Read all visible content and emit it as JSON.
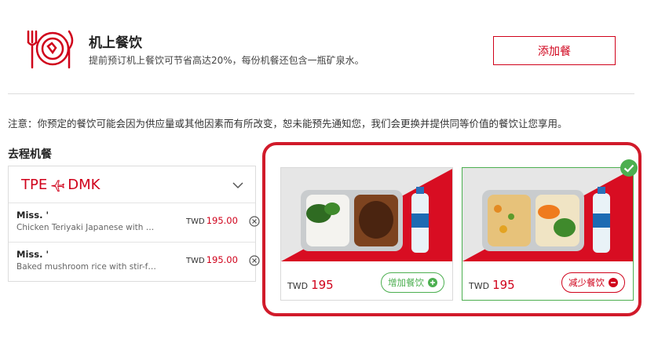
{
  "header": {
    "title": "机上餐饮",
    "subtitle": "提前预订机上餐饮可节省高达20%，每份机餐还包含一瓶矿泉水。",
    "add_meal_label": "添加餐"
  },
  "notice": "注意：你预定的餐饮可能会因为供应量或其他因素而有所改变，恕未能预先通知您，我们会更换并提供同等价值的餐饮让您享用。",
  "section_title": "去程机餐",
  "route": {
    "origin": "TPE",
    "destination": "DMK"
  },
  "passengers": [
    {
      "name": "Miss. '",
      "meal": "Chicken Teriyaki Japanese with Ri...",
      "currency": "TWD",
      "price": "195.00"
    },
    {
      "name": "Miss. '",
      "meal": "Baked mushroom rice with stir-frie...",
      "currency": "TWD",
      "price": "195.00"
    }
  ],
  "meals": [
    {
      "currency": "TWD",
      "price": "195",
      "button_label": "增加餐饮",
      "action": "add",
      "selected": false
    },
    {
      "currency": "TWD",
      "price": "195",
      "button_label": "减少餐饮",
      "action": "remove",
      "selected": true
    }
  ],
  "colors": {
    "accent": "#d0021b",
    "success": "#4caf50",
    "highlight": "#d11a2a"
  },
  "icons": [
    "meal-plate-icon",
    "plane-icon",
    "chevron-down-icon",
    "close-circle-icon",
    "plus-circle-icon",
    "minus-circle-icon",
    "check-badge-icon"
  ]
}
